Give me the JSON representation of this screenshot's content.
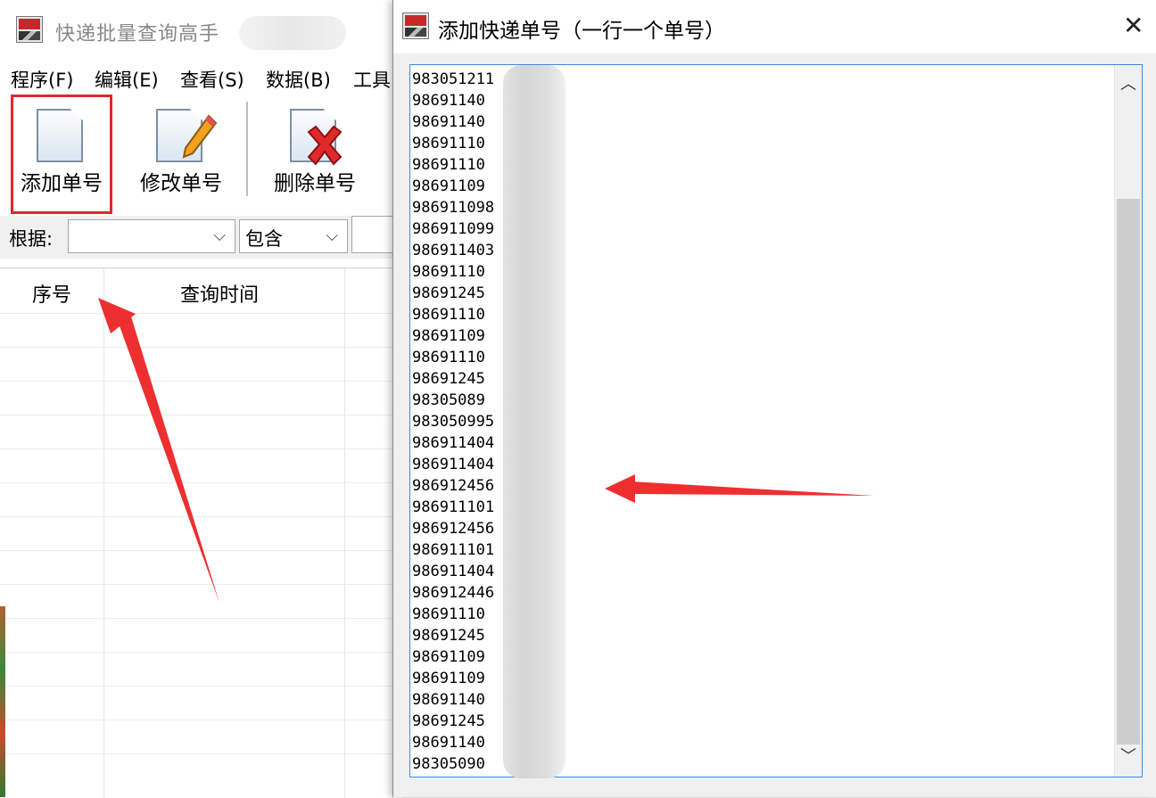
{
  "main_window": {
    "title": "快递批量查询高手",
    "menu": [
      "程序(F)",
      "编辑(E)",
      "查看(S)",
      "数据(B)",
      "工具"
    ],
    "toolbar": {
      "add": "添加单号",
      "edit": "修改单号",
      "delete": "删除单号"
    },
    "filter": {
      "label": "根据:",
      "field_value": "",
      "match_value": "包含",
      "text_value": ""
    },
    "table": {
      "columns": [
        "序号",
        "查询时间"
      ]
    }
  },
  "dialog": {
    "title": "添加快递单号（一行一个单号）",
    "close_label": "✕",
    "tracking_numbers": [
      "983051211",
      "98691140",
      "98691140",
      "98691110",
      "98691110",
      "98691109",
      "986911098",
      "986911099",
      "986911403",
      "98691110",
      "98691245",
      "98691110",
      "98691109",
      "98691110",
      "98691245",
      "98305089",
      "983050995",
      "986911404",
      "986911404",
      "986912456",
      "986911101",
      "986912456",
      "986911101",
      "986911404",
      "986912446",
      "98691110",
      "98691245",
      "98691109",
      "98691109",
      "98691140",
      "98691245",
      "98691140",
      "98305090"
    ]
  },
  "colors": {
    "highlight": "#e0262d",
    "arrow": "#ee2f2f",
    "memo_border": "#3b8ad6"
  }
}
